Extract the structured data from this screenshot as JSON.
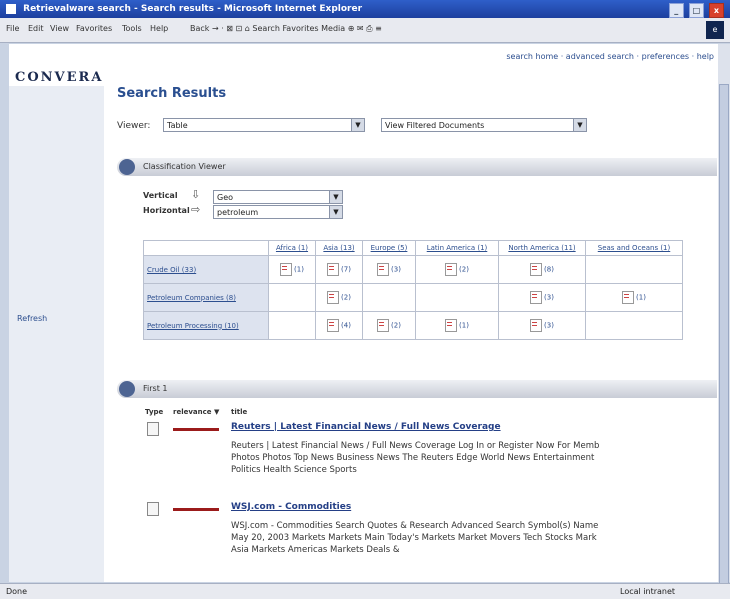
{
  "window": {
    "title": "Retrievalware search - Search results - Microsoft Internet Explorer",
    "buttons": [
      "_",
      "□",
      "x"
    ]
  },
  "toolbar": {
    "menus": [
      "File",
      "Edit",
      "View",
      "Favorites",
      "Tools",
      "Help"
    ],
    "nav": "Back  →  ·  ⊠  ⊡  ⌂   Search  Favorites  Media  ⊕  ✉  ⎙  ≡"
  },
  "toplinks": "search home  ·  advanced search  ·  preferences  ·  help",
  "logo": "CONVERA",
  "leftnav": {
    "item": "Refresh"
  },
  "main": {
    "heading": "Search Results",
    "viewer_label": "Viewer:",
    "viewer_value": "Table",
    "view_select": "View Filtered Documents"
  },
  "classification": {
    "section_title": "Classification Viewer",
    "vertical_label": "Vertical",
    "horizontal_label": "Horizontal",
    "vertical_value": "Geo",
    "horizontal_value": "petroleum",
    "columns": [
      "Africa (1)",
      "Asia (13)",
      "Europe (5)",
      "Latin America (1)",
      "North America (11)",
      "Seas and Oceans (1)"
    ],
    "rows": [
      {
        "label": "Crude Oil (33)",
        "cells": [
          "(1)",
          "(7)",
          "(3)",
          "(2)",
          "(8)",
          ""
        ]
      },
      {
        "label": "Petroleum Companies (8)",
        "cells": [
          "",
          "(2)",
          "",
          "",
          "(3)",
          "(1)"
        ]
      },
      {
        "label": "Petroleum Processing (10)",
        "cells": [
          "",
          "(4)",
          "(2)",
          "(1)",
          "(3)",
          ""
        ]
      }
    ]
  },
  "results_section": {
    "title": "First   1",
    "col_type": "Type",
    "col_relevance": "relevance ▼",
    "col_title": "title",
    "items": [
      {
        "title": "Reuters | Latest Financial News / Full News Coverage",
        "snippet": "Reuters | Latest Financial News / Full News Coverage Log In or Register Now For Memb\nPhotos Photos Top News Business News The Reuters Edge World News Entertainment\nPolitics Health Science Sports"
      },
      {
        "title": "WSJ.com - Commodities",
        "snippet": "WSJ.com - Commodities Search Quotes & Research Advanced Search Symbol(s) Name\nMay 20, 2003 Markets Markets Main Today's Markets Market Movers Tech Stocks Mark\nAsia Markets Americas Markets Deals &"
      }
    ]
  },
  "statusbar": {
    "left": "Done",
    "right": "Local intranet"
  },
  "colors": {
    "accent": "#2a4f90",
    "relevance_bar": "#9b1b1b",
    "title_bar": "#1d3f9e"
  }
}
